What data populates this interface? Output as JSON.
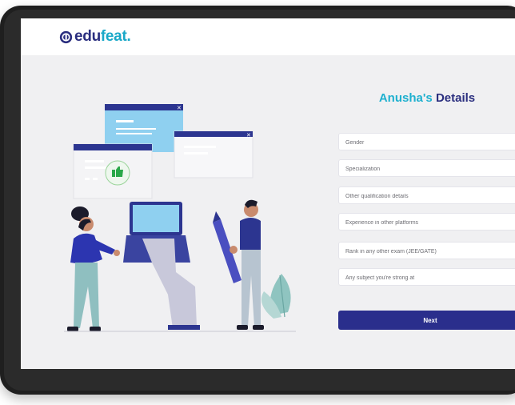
{
  "app": {
    "logo_name": "edufeat",
    "logo_parts": {
      "edu": "edu",
      "feat": "feat",
      "dot": "."
    },
    "brand_colors": {
      "navy": "#2a2e7f",
      "teal": "#1aa8c8",
      "button": "#2a2e8c"
    }
  },
  "form": {
    "title_name": "Anusha's",
    "title_rest": "Details",
    "fields": [
      {
        "placeholder": "Gender"
      },
      {
        "placeholder": "Specialization"
      },
      {
        "placeholder": "Other qualification details"
      },
      {
        "placeholder": "Experience in other platforms"
      },
      {
        "placeholder": "Rank in any other exam (JEE/GATE)"
      },
      {
        "placeholder": "Any subject you're strong at"
      }
    ],
    "next_label": "Next"
  },
  "illustration": {
    "icons": [
      "close-icon",
      "thumbs-up-icon",
      "pencil-icon",
      "plant-icon"
    ]
  }
}
